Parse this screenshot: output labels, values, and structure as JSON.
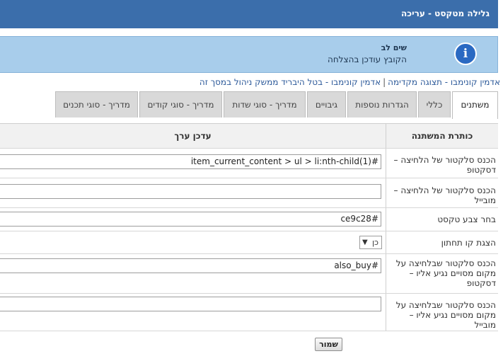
{
  "header": {
    "title": "גלילה מטקסט - עריכה"
  },
  "notice": {
    "title": "שים לב",
    "text": "הקובץ עודכן בהצלחה",
    "icon": "info-icon"
  },
  "links": [
    "אדמין קונימבו - תצוגה מקדימה",
    "אדמין קונימבו - בטל היבריד ממשק ניהול במסך זה"
  ],
  "link_separator": "|",
  "tabs": [
    "משתנים",
    "כללי",
    "הגדרות נוספות",
    "גיבויים",
    "מדריך - סוגי שדות",
    "מדריך - סוגי קודים",
    "מדריך - סוגי תכנים"
  ],
  "table": {
    "col_variable": "כותרת המשתנה",
    "col_value": "עדכן ערך",
    "rows": [
      {
        "label": "הכנס סלקטור של הלחיצה – דסקטופ",
        "value": "#item_current_content > ul > li:nth-child(1)"
      },
      {
        "label": "הכנס סלקטור של הלחיצה – מובייל",
        "value": ""
      },
      {
        "label": "בחר צבע טקסט",
        "value": "#ce9c28"
      },
      {
        "label": "הצגת קו תחתון",
        "value": "כן"
      },
      {
        "label": "הכנס סלקטור שבלחיצה על מקום מסויים נגיע אליו – דסקטופ",
        "value": "#also_buy"
      },
      {
        "label": "הכנס סלקטור שבלחיצה על מקום מסויים נגיע אליו – מובייל",
        "value": ""
      }
    ]
  },
  "save_label": "שמור"
}
